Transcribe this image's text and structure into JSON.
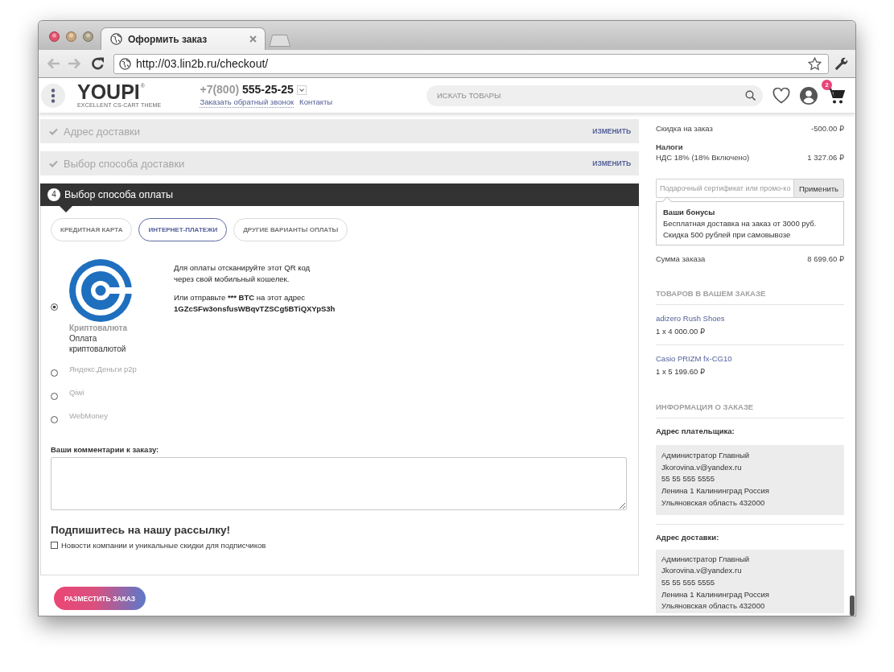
{
  "browser": {
    "tab": {
      "title": "Оформить заказ"
    },
    "nav_buttons": [
      {
        "kind": "back",
        "disabled": true
      },
      {
        "kind": "forward",
        "disabled": true
      },
      {
        "kind": "reload",
        "disabled": false
      }
    ],
    "url": "http://03.lin2b.ru/checkout/"
  },
  "header": {
    "logo": "YOUPI",
    "logo_mark": "®",
    "tagline": "EXCELLENT CS-CART THEME",
    "phone": {
      "code": "+7(800)",
      "number": "555-25-25"
    },
    "links": [
      "Заказать обратный звонок",
      "Контакты"
    ],
    "search": {
      "placeholder": "ИСКАТЬ ТОВАРЫ"
    },
    "cart_count": "2"
  },
  "checkout": {
    "steps": [
      {
        "kind": "completed",
        "title": "Адрес доставки",
        "action": "ИЗМЕНИТЬ"
      },
      {
        "kind": "completed",
        "title": "Выбор способа доставки",
        "action": "ИЗМЕНИТЬ"
      },
      {
        "kind": "current",
        "number": "4",
        "title": "Выбор способа оплаты"
      }
    ],
    "payment_tabs": [
      {
        "label": "КРЕДИТНАЯ КАРТА",
        "selected": false
      },
      {
        "label": "ИНТЕРНЕТ-ПЛАТЕЖИ",
        "selected": true
      },
      {
        "label": "ДРУГИЕ ВАРИАНТЫ ОПЛАТЫ",
        "selected": false
      }
    ],
    "payment_methods": [
      {
        "kind": "detailed",
        "name": "Криптовалюта",
        "description": "Оплата криптовалютой",
        "selected": true,
        "instructions": {
          "qr_hint": [
            "Для оплаты отсканируйте этот QR код",
            "через свой мобильный кошелек."
          ],
          "send": {
            "before": "Или отправьте",
            "amount": "*** BTC",
            "after": "на этот адрес"
          },
          "address": "1GZcSFw3onsfusWBqvTZSCg5BTiQXYpS3h"
        }
      },
      {
        "kind": "simple",
        "name": "Яндекс.Деньги p2p",
        "selected": false
      },
      {
        "kind": "simple",
        "name": "Qiwi",
        "selected": false
      },
      {
        "kind": "simple",
        "name": "WebMoney",
        "selected": false
      }
    ],
    "comments": {
      "label": "Ваши комментарии к заказу:"
    },
    "newsletter": {
      "title": "Подпишитесь на нашу рассылку!",
      "option": {
        "label": "Новости компании и уникальные скидки для подписчиков",
        "checked": false
      }
    },
    "place_order_button": "РАЗМЕСТИТЬ ЗАКАЗ"
  },
  "summary": {
    "lines": [
      {
        "kind": "amount",
        "label": "Скидка на заказ",
        "value": "-500.00 ₽"
      },
      {
        "kind": "group",
        "label": "Налоги"
      },
      {
        "kind": "amount",
        "label": "НДС 18% (18% Включено)",
        "value": "1 327.06 ₽"
      }
    ],
    "promo": {
      "placeholder": "Подарочный сертификат или промо-ко",
      "button": "Применить"
    },
    "bonuses": {
      "title": "Ваши бонусы",
      "lines": [
        "Бесплатная доставка на заказ от 3000 руб.",
        "Скидка 500 рублей при самовывозе"
      ]
    },
    "total": {
      "label": "Сумма заказа",
      "value": "8 699.60 ₽"
    },
    "products": {
      "title": "ТОВАРОВ В ВАШЕМ ЗАКАЗЕ",
      "items": [
        {
          "name": "adizero Rush Shoes",
          "price": "1 x 4 000.00 ₽"
        },
        {
          "name": "Casio PRIZM fx-CG10",
          "price": "1 x 5 199.60 ₽"
        }
      ]
    },
    "order_info": {
      "title": "ИНФОРМАЦИЯ О ЗАКАЗЕ",
      "addresses": [
        {
          "label": "Адрес плательщика:",
          "lines": [
            "Администратор Главный",
            "Jkorovina.v@yandex.ru",
            "55 55 555 5555",
            "Ленина 1 Калининград Россия",
            "Ульяновская область 432000"
          ]
        },
        {
          "label": "Адрес доставки:",
          "lines": [
            "Администратор Главный",
            "Jkorovina.v@yandex.ru",
            "55 55 555 5555",
            "Ленина 1 Калининград Россия",
            "Ульяновская область 432000"
          ]
        }
      ]
    }
  }
}
